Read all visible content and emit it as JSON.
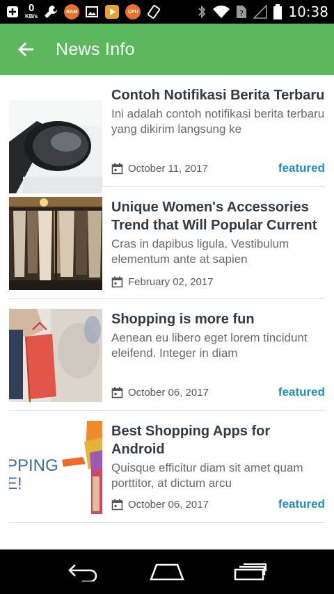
{
  "status_bar": {
    "netspeed_value": "0",
    "netspeed_unit": "KB/s",
    "ram_label": "RAM",
    "cpu_label": "CPU",
    "time": "10:38"
  },
  "app_bar": {
    "title": "News Info"
  },
  "news": [
    {
      "title": "Contoh Notifikasi Berita Terbaru",
      "excerpt": "Ini adalah contoh notifikasi berita terbaru yang dikirim langsung ke",
      "date": "October 11, 2017",
      "tag": "featured",
      "image": "car-mirror"
    },
    {
      "title": "Unique Women's Accessories Trend that Will Popular Current",
      "excerpt": "Cras in dapibus ligula. Vestibulum elementum ante at sapien",
      "date": "February 02, 2017",
      "tag": "",
      "image": "clothing-rack"
    },
    {
      "title": "Shopping is more fun",
      "excerpt": "Aenean eu libero eget lorem tincidunt eleifend. Integer in diam",
      "date": "October 06, 2017",
      "tag": "featured",
      "image": "shopping-bag"
    },
    {
      "title": "Best Shopping Apps for Android",
      "excerpt": "Quisque efficitur diam sit amet quam porttitor, at dictum arcu",
      "date": "October 06, 2017",
      "tag": "featured",
      "image": "shopping-banner",
      "image_text_line1": "PPING",
      "image_text_line2": "E!"
    }
  ],
  "colors": {
    "app_bar": "#5cb85c",
    "tag": "#1f8fc7",
    "title": "#333a40"
  }
}
